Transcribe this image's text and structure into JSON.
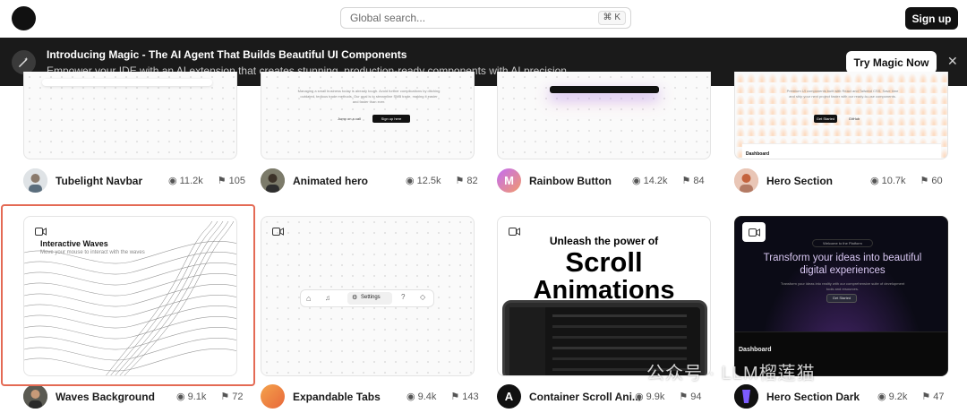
{
  "topbar": {
    "search_placeholder": "Global search...",
    "search_shortcut": "⌘ K",
    "signup_label": "Sign up"
  },
  "banner": {
    "title": "Introducing Magic - The AI Agent That Builds Beautiful UI Components",
    "subtitle": "Empower your IDE with an AI extension that creates stunning, production-ready components with AI precision.",
    "button_label": "Try Magic Now",
    "close_glyph": "✕"
  },
  "icons": {
    "eye": "◉",
    "bookmark": "⚑",
    "camera": "▭"
  },
  "cards": [
    {
      "title": "Tubelight Navbar",
      "views": "11.2k",
      "saves": "105"
    },
    {
      "title": "Animated hero",
      "views": "12.5k",
      "saves": "82",
      "thumb_text": "Managing a small business today is already tough. Avoid further complications by ditching outdated, tedious trade methods. Our goal is to streamline SMB trade, making it easier and faster than ever.",
      "btn1": "Jump on a call",
      "btn2": "Sign up here"
    },
    {
      "title": "Rainbow Button",
      "views": "14.2k",
      "saves": "84",
      "avatar_letter": "M"
    },
    {
      "title": "Hero Section",
      "views": "10.7k",
      "saves": "60",
      "thumb_text": "Premium UI components built with React and Tailwind CSS. Save time and ship your next project faster with our ready-to-use components.",
      "btn1": "Get Started",
      "btn2": "GitHub",
      "dash": "Dashboard"
    },
    {
      "title": "Waves Background",
      "views": "9.1k",
      "saves": "72",
      "thumb_title": "Interactive Waves",
      "thumb_sub": "Move your mouse to interact with the waves"
    },
    {
      "title": "Expandable Tabs",
      "views": "9.4k",
      "saves": "143",
      "tab_label": "Settings"
    },
    {
      "title": "Container Scroll Ani...",
      "views": "9.9k",
      "saves": "94",
      "avatar_letter": "A",
      "thumb_line1": "Unleash the power of",
      "thumb_line2": "Scroll",
      "thumb_line3": "Animations"
    },
    {
      "title": "Hero Section Dark",
      "views": "9.2k",
      "saves": "47",
      "thumb_pill": "Welcome to the Platform",
      "thumb_title": "Transform your ideas into beautiful digital experiences",
      "thumb_sub": "Transform your ideas into reality with our comprehensive suite of development tools and resources.",
      "btn1": "Get Started",
      "dash": "Dashboard"
    }
  ],
  "watermark": "公众号 · LLM榴莲猫"
}
